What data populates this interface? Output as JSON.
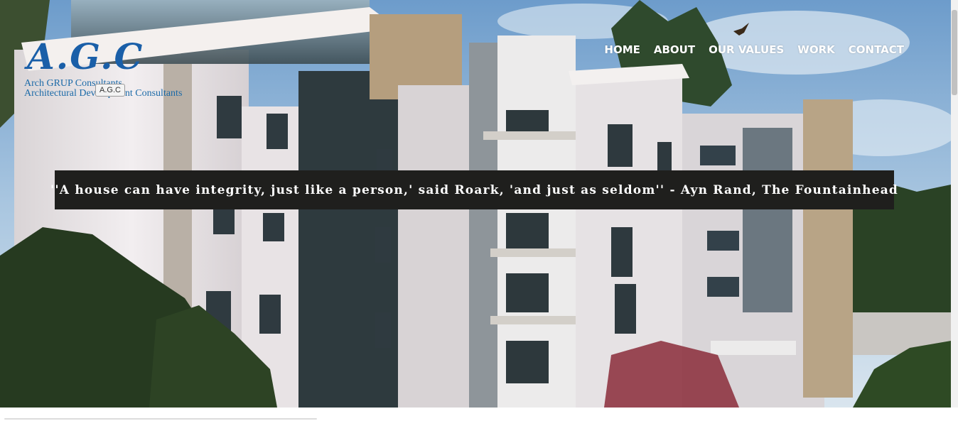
{
  "logo": {
    "mark": "A.G.C",
    "line1": "Arch GRUP Consultants",
    "line2": "Architectural Development Consultants",
    "tooltip": "A.G.C"
  },
  "nav": {
    "items": [
      "HOME",
      "ABOUT",
      "OUR VALUES",
      "WORK",
      "CONTACT"
    ]
  },
  "hero": {
    "quote": "''A house can have integrity, just like a person,' said Roark, 'and just as seldom'' - Ayn Rand, The Fountainhead"
  },
  "colors": {
    "sky": "#7fa9cf",
    "building": "#e9e4e6",
    "glass": "#2c3a40",
    "trees": "#2b3b24",
    "quote_bg": "#1f1f1d",
    "logo_blue": "#1a5fa8"
  }
}
